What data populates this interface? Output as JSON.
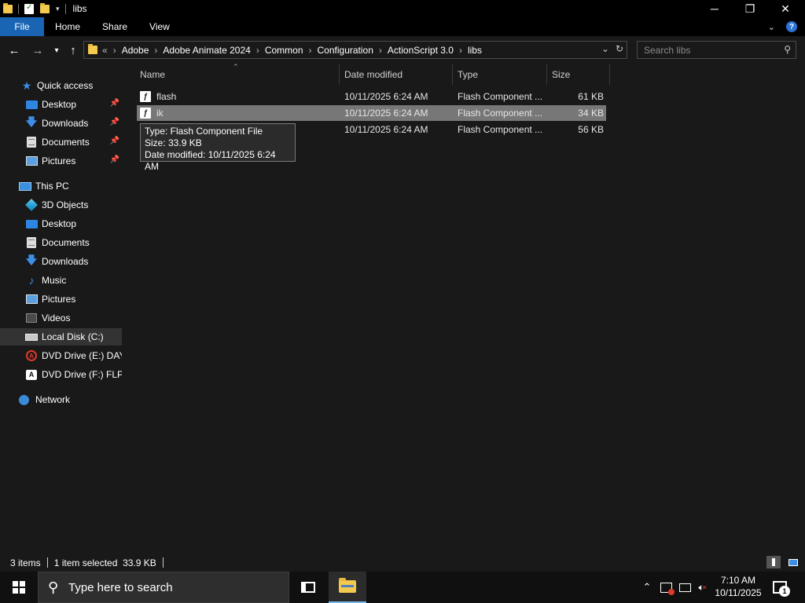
{
  "window": {
    "title": "libs",
    "minimize": "─",
    "maximize": "❐",
    "close": "✕"
  },
  "ribbon": {
    "tabs": [
      "File",
      "Home",
      "Share",
      "View"
    ],
    "expand_icon": "chevron-down-icon",
    "help_label": "?"
  },
  "address": {
    "overflow": "«",
    "breadcrumbs": [
      "Adobe",
      "Adobe Animate 2024",
      "Common",
      "Configuration",
      "ActionScript 3.0",
      "libs"
    ],
    "dropdown": "⌄",
    "refresh": "↻"
  },
  "search": {
    "placeholder": "Search libs"
  },
  "nav": {
    "quick_access": {
      "label": "Quick access",
      "items": [
        {
          "label": "Desktop",
          "icon": "desktop-icon",
          "pinned": true
        },
        {
          "label": "Downloads",
          "icon": "downloads-icon",
          "pinned": true
        },
        {
          "label": "Documents",
          "icon": "documents-icon",
          "pinned": true
        },
        {
          "label": "Pictures",
          "icon": "pictures-icon",
          "pinned": true
        }
      ]
    },
    "this_pc": {
      "label": "This PC",
      "items": [
        {
          "label": "3D Objects",
          "icon": "3d-objects-icon"
        },
        {
          "label": "Desktop",
          "icon": "desktop-icon"
        },
        {
          "label": "Documents",
          "icon": "documents-icon"
        },
        {
          "label": "Downloads",
          "icon": "downloads-icon"
        },
        {
          "label": "Music",
          "icon": "music-icon"
        },
        {
          "label": "Pictures",
          "icon": "pictures-icon"
        },
        {
          "label": "Videos",
          "icon": "videos-icon"
        },
        {
          "label": "Local Disk (C:)",
          "icon": "local-disk-icon",
          "selected": true
        },
        {
          "label": "DVD Drive (E:) DAY_",
          "icon": "dvd-drive-e-icon"
        },
        {
          "label": "DVD Drive (F:) FLPR",
          "icon": "dvd-drive-f-icon"
        }
      ]
    },
    "network": {
      "label": "Network",
      "icon": "network-icon"
    }
  },
  "columns": {
    "name": "Name",
    "date": "Date modified",
    "type": "Type",
    "size": "Size"
  },
  "files": [
    {
      "name": "flash",
      "date": "10/11/2025 6:24 AM",
      "type": "Flash Component ...",
      "size": "61 KB",
      "selected": false
    },
    {
      "name": "ik",
      "date": "10/11/2025 6:24 AM",
      "type": "Flash Component ...",
      "size": "34 KB",
      "selected": true
    },
    {
      "name": "",
      "date": "10/11/2025 6:24 AM",
      "type": "Flash Component ...",
      "size": "56 KB",
      "selected": false
    }
  ],
  "tooltip": {
    "type_line": "Type: Flash Component File",
    "size_line": "Size: 33.9 KB",
    "date_line": "Date modified: 10/11/2025 6:24 AM"
  },
  "status": {
    "count": "3 items",
    "selection": "1 item selected  33.9 KB"
  },
  "taskbar": {
    "search_placeholder": "Type here to search",
    "time": "7:10 AM",
    "date": "10/11/2025",
    "notification_count": "1"
  },
  "colors": {
    "file_tab": "#1a64b4",
    "selected_row": "#777777",
    "folder": "#f3c94e",
    "accent_blue": "#3d8ee6"
  }
}
